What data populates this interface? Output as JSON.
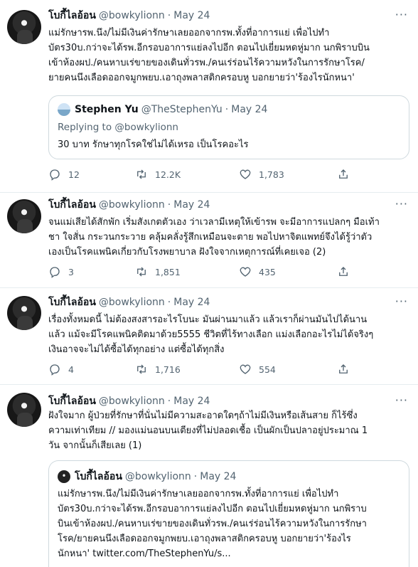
{
  "tweets": [
    {
      "name": "โบกี้ไลอ้อน",
      "handle": "@bowkylionn",
      "dot": "·",
      "date": "May 24",
      "lines": [
        "แม่รักษารพ.นึง/ไม่มีเงินค่ารักษาเลยออกจากรพ.ทั้งที่อาการแย่ เพื่อไปทำ",
        "บัตร30บ.กว่าจะได้รพ.อีกรอบอาการแย่ลงไปอีก ตอนไปเยี่ยมหดหู่มาก นกพิราบบิน",
        "เข้าห้องผป./คนหาบเร่ขายของเดินทั่วรพ./คนเร่ร่อนไร้ความหวังในการรักษาโรค/",
        "ยายคนนึงเลือดออกจมูกพยบ.เอาถุงพลาสติกครอบหู บอกยายว่า'ร้องไรนักหนา'"
      ],
      "quote": {
        "name": "Stephen Yu",
        "handle": "@TheStephenYu",
        "dot": "·",
        "date": "May 24",
        "reply": "Replying to @bowkylionn",
        "lines": [
          "30 บาท รักษาทุกโรคใช่ไม่ได้เหรอ เป็นโรคอะไร"
        ]
      },
      "stats": {
        "reply": "12",
        "retweet": "12.2K",
        "like": "1,783"
      }
    },
    {
      "name": "โบกี้ไลอ้อน",
      "handle": "@bowkylionn",
      "dot": "·",
      "date": "May 24",
      "lines": [
        "จนแม่เสียได้สักพัก เริ่มสังเกตตัวเอง ว่าเวลามีเหตุให้เข้ารพ จะมีอาการแปลกๆ มือเท้า",
        "ชา ใจสั่น กระวนกระวาย คลุ้มคลั่งรู้สึกเหมือนจะตาย พอไปหาจิตแพทย์จึงได้รู้ว่าตัว",
        "เองเป็นโรคแพนิคเกี่ยวกับโรงพยาบาล ฝังใจจากเหตุการณ์ที่เคยเจอ (2)"
      ],
      "stats": {
        "reply": "3",
        "retweet": "1,851",
        "like": "435"
      }
    },
    {
      "name": "โบกี้ไลอ้อน",
      "handle": "@bowkylionn",
      "dot": "·",
      "date": "May 24",
      "lines": [
        "เรื่องทั้งหมดนี้ ไม่ต้องสงสารอะไรโบนะ มันผ่านมาแล้ว แล้วเราก็ผ่านมันไปได้นาน",
        "แล้ว แม้จะมีโรคแพนิคติดมาด้วย5555 ชีวิตที่ไร้ทางเลือก แม่งเลือกอะไรไม่ได้จริงๆ",
        "เงินอาจจะไม่ได้ซื้อได้ทุกอย่าง แต่ซื้อได้ทุกสิ่ง"
      ],
      "stats": {
        "reply": "4",
        "retweet": "1,716",
        "like": "554"
      }
    },
    {
      "name": "โบกี้ไลอ้อน",
      "handle": "@bowkylionn",
      "dot": "·",
      "date": "May 24",
      "lines": [
        "ฝังใจมาก ผู้ป่วยที่รักษาที่นั่นไม่มีความสะอาดใดๆถ้าไม่มีเงินหรือเส้นสาย ก็ไร้ซึ่ง",
        "ความเท่าเทียม // มองแม่นอนบนเตียงที่ไม่ปลอดเชื้อ เป็นผักเป็นปลาอยู่ประมาณ 1",
        "วัน จากนั้นก็เสียเลย (1)"
      ],
      "quote": {
        "name": "โบกี้ไลอ้อน",
        "handle": "@bowkylionn",
        "dot": "·",
        "date": "May 24",
        "lines": [
          "แม่รักษารพ.นึง/ไม่มีเงินค่ารักษาเลยออกจากรพ.ทั้งที่อาการแย่ เพื่อไปทำ",
          "บัตร30บ.กว่าจะได้รพ.อีกรอบอาการแย่ลงไปอีก ตอนไปเยี่ยมหดหู่มาก นกพิราบ",
          "บินเข้าห้องผป./คนหาบเร่ขายของเดินทั่วรพ./คนเร่ร่อนไร้ความหวังในการรักษา",
          "โรค/ยายคนนึงเลือดออกจมูกพยบ.เอาถุงพลาสติกครอบหู บอกยายว่า'ร้องไร",
          "นักหนา' twitter.com/TheStephenYu/s..."
        ]
      }
    }
  ],
  "more_icon": "more-horizontal-icon",
  "colors": {
    "muted": "#536471",
    "border": "#cfd9de",
    "divider": "#e6ecf0"
  }
}
